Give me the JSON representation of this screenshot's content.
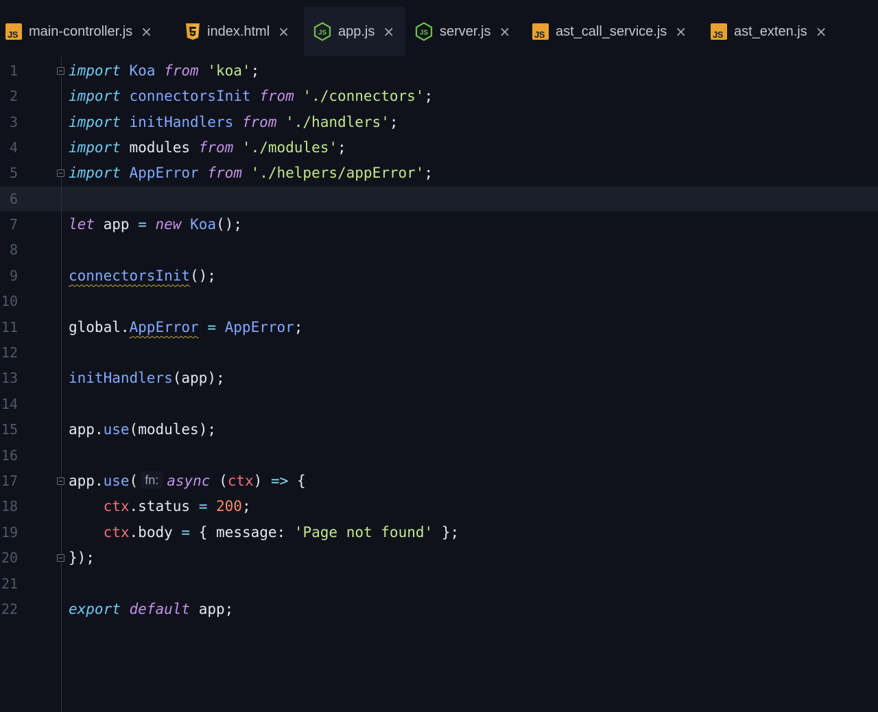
{
  "tabs": [
    {
      "label": "main-controller.js",
      "icon": "js-file-icon",
      "active": false
    },
    {
      "label": "index.html",
      "icon": "html5-file-icon",
      "active": false
    },
    {
      "label": "app.js",
      "icon": "nodejs-file-icon",
      "active": true
    },
    {
      "label": "server.js",
      "icon": "nodejs-file-icon",
      "active": false
    },
    {
      "label": "ast_call_service.js",
      "icon": "js-file-icon",
      "active": false
    },
    {
      "label": "ast_exten.js",
      "icon": "js-file-icon",
      "active": false
    }
  ],
  "tab_close_glyph": "×",
  "js_icon_text": "JS",
  "editor": {
    "current_line": 6,
    "line_numbers": [
      "1",
      "2",
      "3",
      "4",
      "5",
      "6",
      "7",
      "8",
      "9",
      "10",
      "11",
      "12",
      "13",
      "14",
      "15",
      "16",
      "17",
      "18",
      "19",
      "20",
      "21",
      "22"
    ],
    "inlay_hint": "fn:",
    "tokens": {
      "import": "import",
      "from": "from",
      "let": "let",
      "new": "new",
      "async": "async",
      "export": "export",
      "default": "default",
      "Koa": "Koa",
      "connectorsInit": "connectorsInit",
      "initHandlers": "initHandlers",
      "modules": "modules",
      "AppError": "AppError",
      "app": "app",
      "global": "global",
      "use": "use",
      "ctx": "ctx",
      "status": "status",
      "body": "body",
      "message": "message",
      "str_koa": "'koa'",
      "str_connectors": "'./connectors'",
      "str_handlers": "'./handlers'",
      "str_modules": "'./modules'",
      "str_apperror": "'./helpers/appError'",
      "str_notfound": "'Page not found'",
      "num_200": "200"
    }
  },
  "colors": {
    "background": "#0f121b",
    "active_tab": "#181c27",
    "current_line": "#1a1f2a",
    "keyword_import": "#6ecbf5",
    "keyword_other": "#c792ea",
    "string": "#c3e88d",
    "class_function": "#82aaff",
    "number": "#f78c6c",
    "parameter": "#f07178",
    "js_icon": "#e8a030",
    "html_icon": "#e8a030",
    "node_icon": "#6cc24a"
  }
}
